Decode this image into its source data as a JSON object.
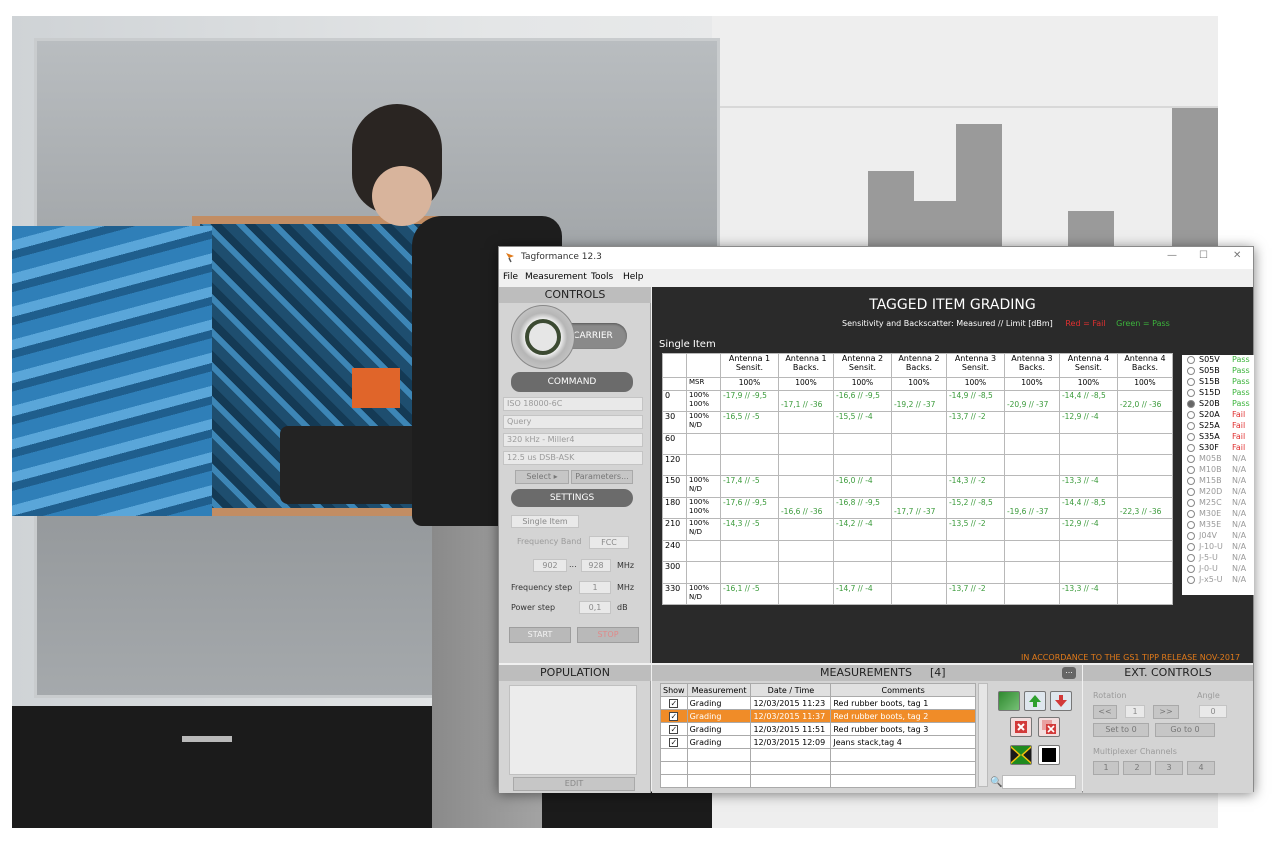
{
  "window": {
    "title": "Tagformance 12.3"
  },
  "menu": [
    "File",
    "Measurement",
    "Tools",
    "Help"
  ],
  "controls": {
    "header": "CONTROLS",
    "carrier_label": "CARRIER",
    "command_label": "COMMAND",
    "fields": [
      "ISO 18000-6C",
      "Query",
      "320 kHz - Miller4",
      "12.5 us DSB-ASK"
    ],
    "select_label": "Select",
    "parameters_label": "Parameters...",
    "settings_label": "SETTINGS",
    "mode": "Single Item",
    "frequency_band_label": "Frequency Band",
    "frequency_band_value": "FCC",
    "freq_from": "902",
    "freq_dots": "...",
    "freq_to": "928",
    "freq_unit": "MHz",
    "frequency_step_label": "Frequency step",
    "frequency_step_value": "1",
    "frequency_step_unit": "MHz",
    "power_step_label": "Power step",
    "power_step_value": "0,1",
    "power_step_unit": "dB",
    "start_label": "START",
    "stop_label": "STOP"
  },
  "grading": {
    "title": "TAGGED ITEM GRADING",
    "subtitle": "Sensitivity and Backscatter: Measured // Limit [dBm]",
    "red_legend": "Red = Fail",
    "green_legend": "Green = Pass",
    "single_item_label": "Single Item",
    "columns": [
      [
        "Antenna 1",
        "Sensit."
      ],
      [
        "Antenna 1",
        "Backs."
      ],
      [
        "Antenna 2",
        "Sensit."
      ],
      [
        "Antenna 2",
        "Backs."
      ],
      [
        "Antenna 3",
        "Sensit."
      ],
      [
        "Antenna 3",
        "Backs."
      ],
      [
        "Antenna 4",
        "Sensit."
      ],
      [
        "Antenna 4",
        "Backs."
      ]
    ],
    "msr_label": "MSR",
    "msr_values": [
      "100%",
      "100%",
      "100%",
      "100%",
      "100%",
      "100%",
      "100%",
      "100%"
    ],
    "rows": [
      {
        "angle": "0",
        "msr": [
          "100%",
          "100%"
        ],
        "cells": [
          "-17,9 // -9,5",
          "-17,1 // -36",
          "-16,6 // -9,5",
          "-19,2 // -37",
          "-14,9 // -8,5",
          "-20,9 // -37",
          "-14,4 // -8,5",
          "-22,0 // -36"
        ]
      },
      {
        "angle": "30",
        "msr": [
          "100%",
          "N/D"
        ],
        "cells": [
          "-16,5 // -5",
          "",
          "-15,5 // -4",
          "",
          "-13,7 // -2",
          "",
          "-12,9 // -4",
          ""
        ]
      },
      {
        "angle": "60",
        "msr": [
          "",
          ""
        ],
        "cells": [
          "",
          "",
          "",
          "",
          "",
          "",
          "",
          ""
        ]
      },
      {
        "angle": "120",
        "msr": [
          "",
          ""
        ],
        "cells": [
          "",
          "",
          "",
          "",
          "",
          "",
          "",
          ""
        ]
      },
      {
        "angle": "150",
        "msr": [
          "100%",
          "N/D"
        ],
        "cells": [
          "-17,4 // -5",
          "",
          "-16,0 // -4",
          "",
          "-14,3 // -2",
          "",
          "-13,3 // -4",
          ""
        ]
      },
      {
        "angle": "180",
        "msr": [
          "100%",
          "100%"
        ],
        "cells": [
          "-17,6 // -9,5",
          "-16,6 // -36",
          "-16,8 // -9,5",
          "-17,7 // -37",
          "-15,2 // -8,5",
          "-19,6 // -37",
          "-14,4 // -8,5",
          "-22,3 // -36"
        ]
      },
      {
        "angle": "210",
        "msr": [
          "100%",
          "N/D"
        ],
        "cells": [
          "-14,3 // -5",
          "",
          "-14,2 // -4",
          "",
          "-13,5 // -2",
          "",
          "-12,9 // -4",
          ""
        ]
      },
      {
        "angle": "240",
        "msr": [
          "",
          ""
        ],
        "cells": [
          "",
          "",
          "",
          "",
          "",
          "",
          "",
          ""
        ]
      },
      {
        "angle": "300",
        "msr": [
          "",
          ""
        ],
        "cells": [
          "",
          "",
          "",
          "",
          "",
          "",
          "",
          ""
        ]
      },
      {
        "angle": "330",
        "msr": [
          "100%",
          "N/D"
        ],
        "cells": [
          "-16,1 // -5",
          "",
          "-14,7 // -4",
          "",
          "-13,7 // -2",
          "",
          "-13,3 // -4",
          ""
        ]
      }
    ],
    "classes": [
      {
        "name": "S05V",
        "status": "Pass"
      },
      {
        "name": "S05B",
        "status": "Pass"
      },
      {
        "name": "S15B",
        "status": "Pass"
      },
      {
        "name": "S15D",
        "status": "Pass"
      },
      {
        "name": "S20B",
        "status": "Pass"
      },
      {
        "name": "S20A",
        "status": "Fail"
      },
      {
        "name": "S25A",
        "status": "Fail"
      },
      {
        "name": "S35A",
        "status": "Fail"
      },
      {
        "name": "S30F",
        "status": "Fail"
      },
      {
        "name": "M05B",
        "status": "N/A"
      },
      {
        "name": "M10B",
        "status": "N/A"
      },
      {
        "name": "M15B",
        "status": "N/A"
      },
      {
        "name": "M20D",
        "status": "N/A"
      },
      {
        "name": "M25C",
        "status": "N/A"
      },
      {
        "name": "M30E",
        "status": "N/A"
      },
      {
        "name": "M35E",
        "status": "N/A"
      },
      {
        "name": "J04V",
        "status": "N/A"
      },
      {
        "name": "J-10-U",
        "status": "N/A"
      },
      {
        "name": "J-5-U",
        "status": "N/A"
      },
      {
        "name": "J-0-U",
        "status": "N/A"
      },
      {
        "name": "J-x5-U",
        "status": "N/A"
      }
    ],
    "selected_class": "S20B",
    "footnote": "IN ACCORDANCE TO THE GS1 TIPP RELEASE NOV-2017",
    "colors": {
      "pass": "#3cb43c",
      "fail": "#e03030",
      "na": "#9a9a9a",
      "footnote": "#e07a1a"
    }
  },
  "population": {
    "header": "POPULATION",
    "edit_label": "EDIT"
  },
  "measurements": {
    "header": "MEASUREMENTS",
    "count": "[4]",
    "more_label": "...",
    "columns": [
      "Show",
      "Measurement",
      "Date / Time",
      "Comments"
    ],
    "rows": [
      {
        "show": true,
        "measurement": "Grading",
        "datetime": "12/03/2015 11:23",
        "comment": "Red rubber boots, tag 1"
      },
      {
        "show": true,
        "measurement": "Grading",
        "datetime": "12/03/2015 11:37",
        "comment": "Red rubber boots, tag 2",
        "selected": true
      },
      {
        "show": true,
        "measurement": "Grading",
        "datetime": "12/03/2015 11:51",
        "comment": "Red rubber boots, tag 3"
      },
      {
        "show": true,
        "measurement": "Grading",
        "datetime": "12/03/2015 12:09",
        "comment": "Jeans stack,tag 4"
      }
    ],
    "check_mark": "✓",
    "search_icon": "search-icon"
  },
  "ext_controls": {
    "header": "EXT. CONTROLS",
    "rotation_label": "Rotation",
    "angle_label": "Angle",
    "prev_label": "<<",
    "step_value": "1",
    "next_label": ">>",
    "angle_value": "0",
    "set_to_0": "Set to 0",
    "go_to_0": "Go to 0",
    "multiplexer_label": "Multiplexer Channels",
    "channels": [
      "1",
      "2",
      "3",
      "4"
    ]
  }
}
